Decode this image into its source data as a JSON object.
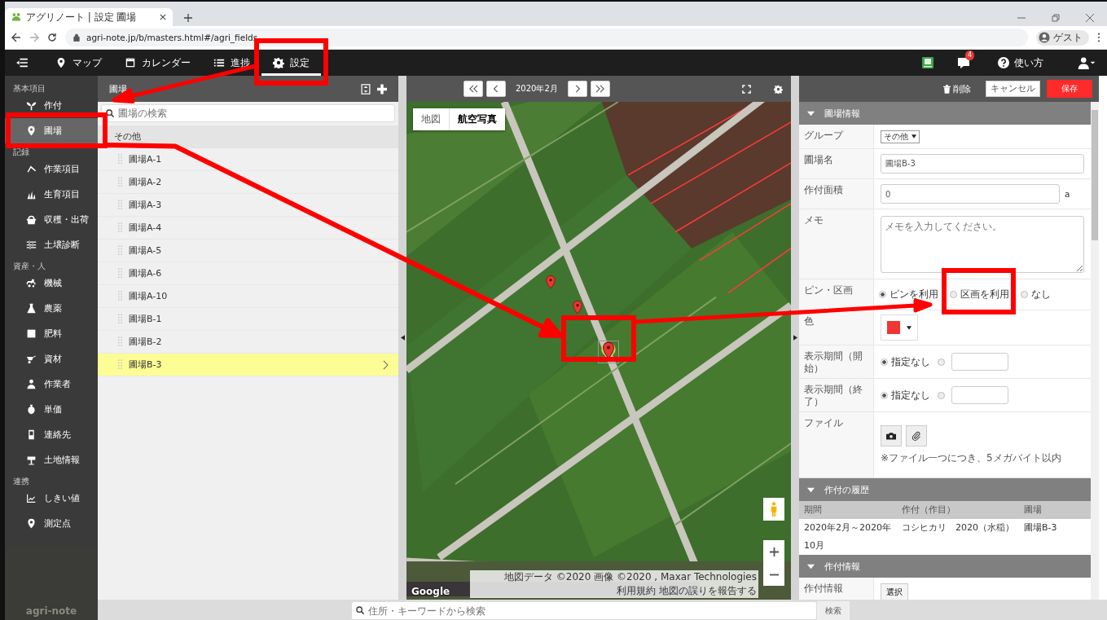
{
  "browser": {
    "tab_title": "アグリノート | 設定 圃場",
    "address": "agri-note.jp/b/masters.html#/agri_fields",
    "profile": "ゲスト"
  },
  "nav": {
    "tabs": [
      {
        "label": "マップ",
        "selected": false
      },
      {
        "label": "カレンダー",
        "selected": false
      },
      {
        "label": "進捗",
        "selected": false
      },
      {
        "label": "設定",
        "selected": true
      }
    ],
    "notification_count": "4",
    "help": "使い方"
  },
  "sidebar": {
    "sections": [
      {
        "title": "基本項目",
        "items": [
          {
            "label": "作付",
            "selected": false
          },
          {
            "label": "圃場",
            "selected": true
          }
        ]
      },
      {
        "title": "記録",
        "items": [
          {
            "label": "作業項目",
            "selected": false
          },
          {
            "label": "生育項目",
            "selected": false
          },
          {
            "label": "収穫・出荷",
            "selected": false
          },
          {
            "label": "土壌診断",
            "selected": false
          }
        ]
      },
      {
        "title": "資産・人",
        "items": [
          {
            "label": "機械",
            "selected": false
          },
          {
            "label": "農薬",
            "selected": false
          },
          {
            "label": "肥料",
            "selected": false
          },
          {
            "label": "資材",
            "selected": false
          },
          {
            "label": "作業者",
            "selected": false
          },
          {
            "label": "単価",
            "selected": false
          },
          {
            "label": "連絡先",
            "selected": false
          },
          {
            "label": "土地情報",
            "selected": false
          }
        ]
      },
      {
        "title": "連携",
        "items": [
          {
            "label": "しきい値",
            "selected": false
          },
          {
            "label": "測定点",
            "selected": false
          }
        ]
      }
    ],
    "logo": "agri-note"
  },
  "list": {
    "title": "圃場",
    "search_placeholder": "圃場の検索",
    "group": "その他",
    "items": [
      {
        "label": "圃場A-1",
        "selected": false
      },
      {
        "label": "圃場A-2",
        "selected": false
      },
      {
        "label": "圃場A-3",
        "selected": false
      },
      {
        "label": "圃場A-4",
        "selected": false
      },
      {
        "label": "圃場A-5",
        "selected": false
      },
      {
        "label": "圃場A-6",
        "selected": false
      },
      {
        "label": "圃場A-10",
        "selected": false
      },
      {
        "label": "圃場B-1",
        "selected": false
      },
      {
        "label": "圃場B-2",
        "selected": false
      },
      {
        "label": "圃場B-3",
        "selected": true
      }
    ]
  },
  "map": {
    "month": "2020年2月",
    "map_types": [
      {
        "label": "地図",
        "selected": false
      },
      {
        "label": "航空写真",
        "selected": true
      }
    ],
    "google": "Google",
    "attribution": "地図データ ©2020 画像 ©2020 , Maxar Technologies",
    "terms": "利用規約",
    "report": "地図の誤りを報告する"
  },
  "detail": {
    "delete": "削除",
    "cancel": "キャンセル",
    "save": "保存",
    "sections": [
      {
        "title": "圃場情報",
        "expanded": true,
        "rows": [
          {
            "kind": "select",
            "label": "グループ",
            "value": "その他"
          },
          {
            "kind": "input",
            "label": "圃場名",
            "value": "圃場B-3"
          },
          {
            "kind": "input",
            "label": "作付面積",
            "value": "0",
            "unit": "a"
          },
          {
            "kind": "textarea",
            "label": "メモ",
            "placeholder": "メモを入力してください。"
          },
          {
            "kind": "radio",
            "label": "ピン・区画",
            "options": [
              {
                "label": "ピンを利用",
                "selected": true
              },
              {
                "label": "区画を利用",
                "selected": false
              },
              {
                "label": "なし",
                "selected": false
              }
            ]
          },
          {
            "kind": "color",
            "label": "色",
            "color": "#f03535"
          },
          {
            "kind": "period",
            "label": "表示期間（開始）",
            "none_label": "指定なし",
            "none_selected": true
          },
          {
            "kind": "period",
            "label": "表示期間（終了）",
            "none_label": "指定なし",
            "none_selected": true
          },
          {
            "kind": "file",
            "label": "ファイル",
            "note": "※ファイル一つにつき、5メガバイト以内"
          }
        ]
      },
      {
        "title": "作付の履歴",
        "expanded": true,
        "table": {
          "columns": [
            "期間",
            "作付（作目）",
            "圃場"
          ],
          "rows": [
            [
              "2020年2月～2020年10月",
              "コシヒカリ　2020（水稲）",
              "圃場B-3"
            ]
          ]
        }
      },
      {
        "title": "作付情報",
        "expanded": true,
        "rows": [
          {
            "kind": "button",
            "label": "作付情報",
            "button": "選択"
          }
        ]
      }
    ]
  },
  "bottom": {
    "search_placeholder": "住所・キーワードから検索",
    "search_button": "検索"
  }
}
